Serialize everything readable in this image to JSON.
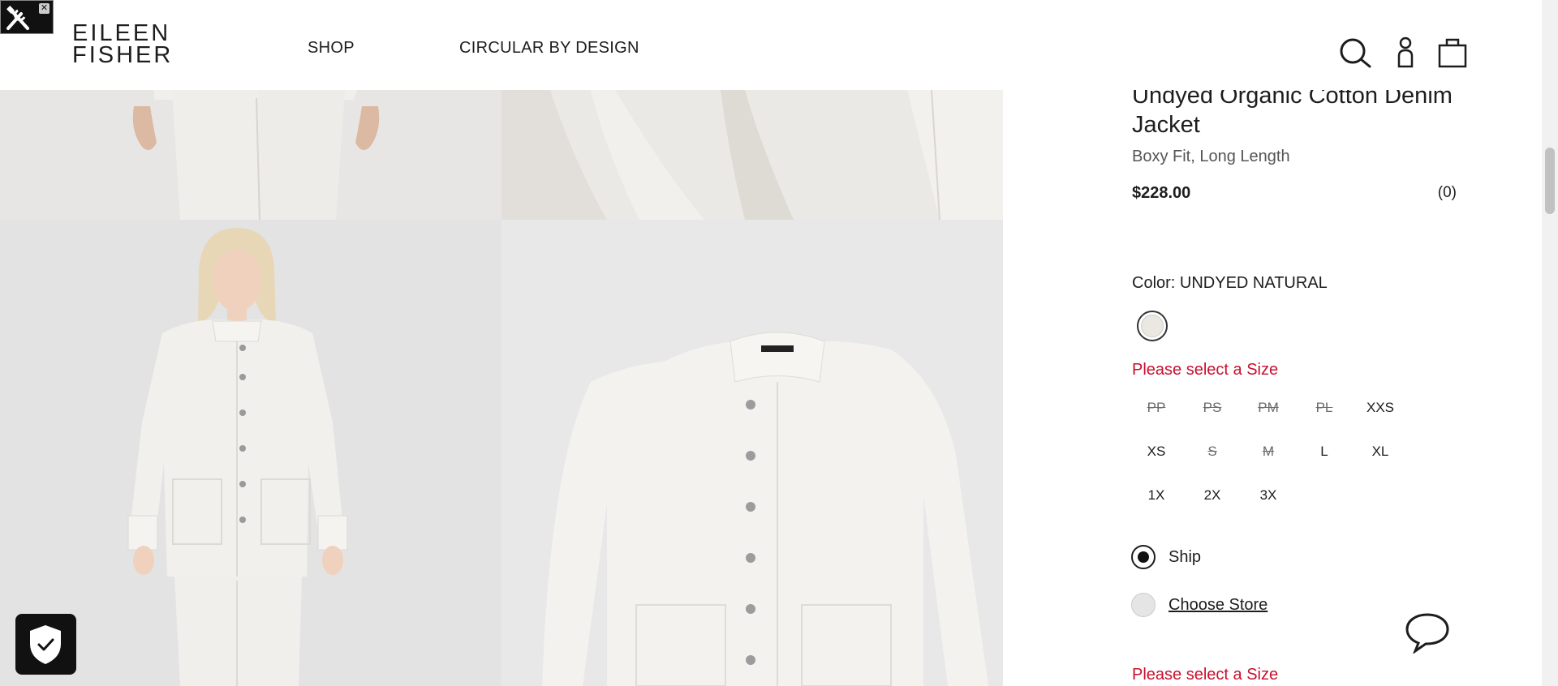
{
  "brand": {
    "line1": "EILEEN",
    "line2": "FISHER"
  },
  "nav": {
    "shop": "SHOP",
    "circular": "CIRCULAR BY DESIGN"
  },
  "header_icons": [
    "search-icon",
    "account-icon",
    "bag-icon"
  ],
  "product": {
    "title": "Undyed Organic Cotton Denim Jacket",
    "subtitle": "Boxy Fit, Long Length",
    "price": "$228.00",
    "reviews": "(0)",
    "color_label": "Color: UNDYED NATURAL",
    "swatch_color": "#ebe8e1",
    "size_error": "Please select a Size",
    "sizes": [
      {
        "label": "PP",
        "available": false
      },
      {
        "label": "PS",
        "available": false
      },
      {
        "label": "PM",
        "available": false
      },
      {
        "label": "PL",
        "available": false
      },
      {
        "label": "XXS",
        "available": true
      },
      {
        "label": "XS",
        "available": true
      },
      {
        "label": "S",
        "available": false
      },
      {
        "label": "M",
        "available": false
      },
      {
        "label": "L",
        "available": true
      },
      {
        "label": "XL",
        "available": true
      },
      {
        "label": "1X",
        "available": true
      },
      {
        "label": "2X",
        "available": true
      },
      {
        "label": "3X",
        "available": true
      }
    ],
    "fulfillment": {
      "ship": "Ship",
      "store": "Choose Store",
      "selected": "ship"
    },
    "size_error_bottom": "Please select a Size"
  },
  "colors": {
    "error": "#c8102e",
    "text": "#1d1d1d",
    "gallery_bg": "#e3e3e3"
  }
}
